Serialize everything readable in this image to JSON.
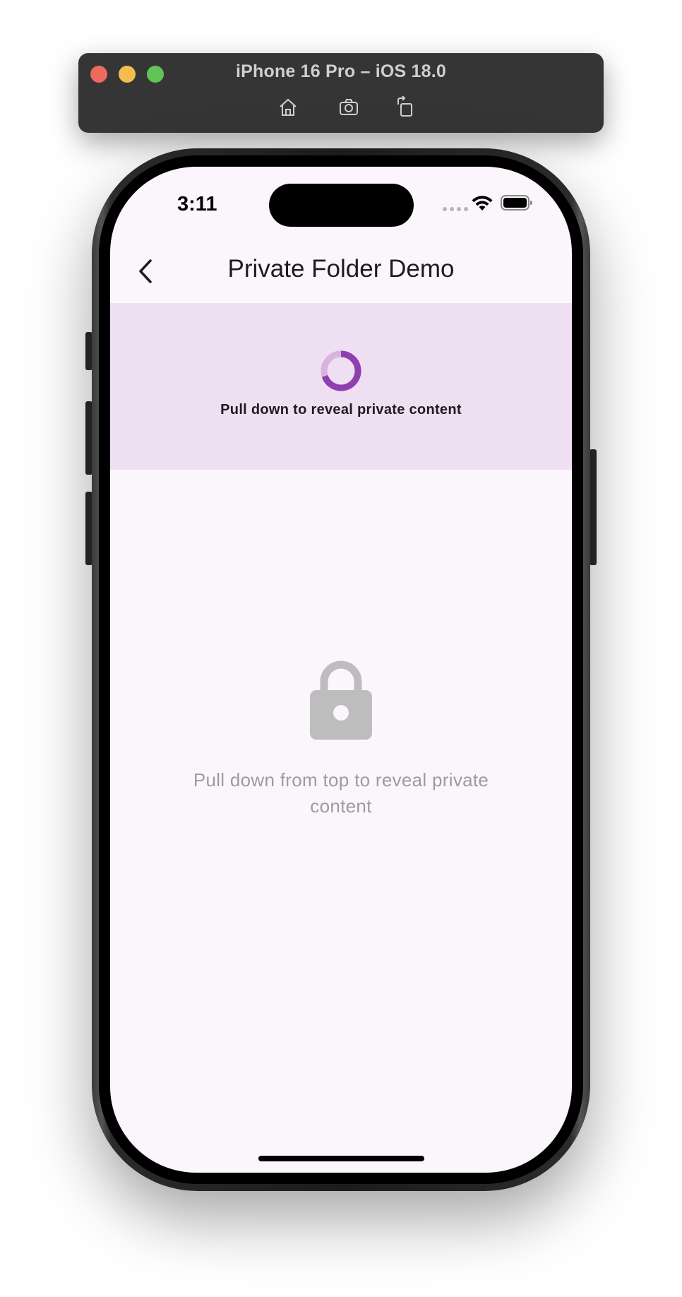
{
  "simulator": {
    "title": "iPhone 16 Pro – iOS 18.0",
    "buttons": [
      {
        "name": "home-icon"
      },
      {
        "name": "screenshot-icon"
      },
      {
        "name": "rotate-icon"
      }
    ]
  },
  "status_bar": {
    "time": "3:11"
  },
  "nav": {
    "title": "Private Folder Demo",
    "back_icon": "chevron-left-icon"
  },
  "reveal": {
    "text": "Pull down to reveal private content",
    "spinner_color": "#8e44ad",
    "panel_color": "#efdff2"
  },
  "placeholder": {
    "icon": "lock-icon",
    "text": "Pull down from top to reveal private content"
  },
  "colors": {
    "screen_background": "#fbf6fc",
    "muted_text": "#9e9b9f"
  }
}
